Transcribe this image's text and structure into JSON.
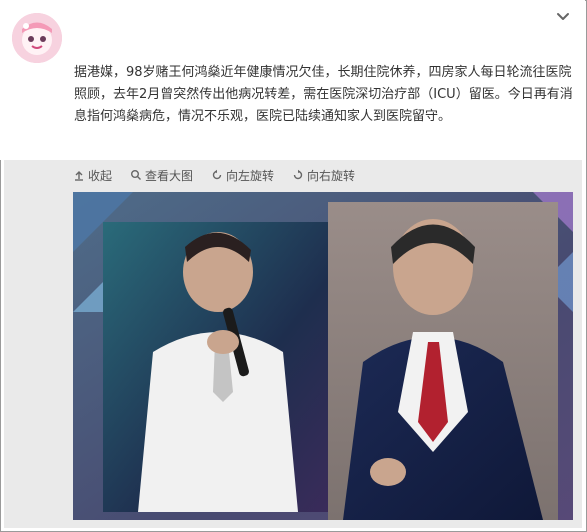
{
  "post": {
    "avatar_icon": "cartoon-avatar",
    "text": "据港媒，98岁赌王何鸿燊近年健康情况欠佳，长期住院休养，四房家人每日轮流往医院照顾，去年2月曾突然传出他病况转差，需在医院深切治疗部（ICU）留医。今日再有消息指何鸿燊病危，情况不乐观，医院已陆续通知家人到医院留守。"
  },
  "toolbar": {
    "collapse_label": "收起",
    "view_large_label": "查看大图",
    "rotate_left_label": "向左旋转",
    "rotate_right_label": "向右旋转"
  },
  "photo": {
    "description_icon": "photo-two-portraits"
  },
  "colors": {
    "background": "#eaeaea",
    "text": "#333333",
    "toolbar_text": "#555555"
  }
}
